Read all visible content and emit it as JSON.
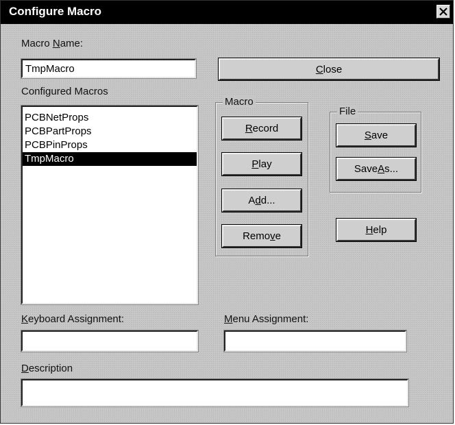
{
  "window": {
    "title": "Configure Macro",
    "close_icon": "close-icon"
  },
  "macro_name": {
    "label_pre": "Macro ",
    "label_key": "N",
    "label_post": "ame:",
    "value": "TmpMacro"
  },
  "configured_macros": {
    "label": "Configured Macros",
    "items": [
      "PCBNetProps",
      "PCBPartProps",
      "PCBPinProps",
      "TmpMacro"
    ],
    "selected": "TmpMacro"
  },
  "buttons": {
    "close": {
      "pre": "",
      "key": "C",
      "post": "lose"
    },
    "record": {
      "pre": "",
      "key": "R",
      "post": "ecord"
    },
    "play": {
      "pre": "",
      "key": "P",
      "post": "lay"
    },
    "add": {
      "pre": "A",
      "key": "d",
      "post": "d..."
    },
    "remove": {
      "pre": "Remo",
      "key": "v",
      "post": "e"
    },
    "save": {
      "pre": "",
      "key": "S",
      "post": "ave"
    },
    "save_as": {
      "pre": "Save ",
      "key": "A",
      "post": "s..."
    },
    "help": {
      "pre": "",
      "key": "H",
      "post": "elp"
    }
  },
  "groups": {
    "macro": "Macro",
    "file": "File"
  },
  "keyboard_assignment": {
    "label_pre": "",
    "label_key": "K",
    "label_post": "eyboard Assignment:",
    "value": ""
  },
  "menu_assignment": {
    "label_pre": "",
    "label_key": "M",
    "label_post": "enu Assignment:",
    "value": ""
  },
  "description": {
    "label_pre": "",
    "label_key": "D",
    "label_post": "escription",
    "value": ""
  }
}
